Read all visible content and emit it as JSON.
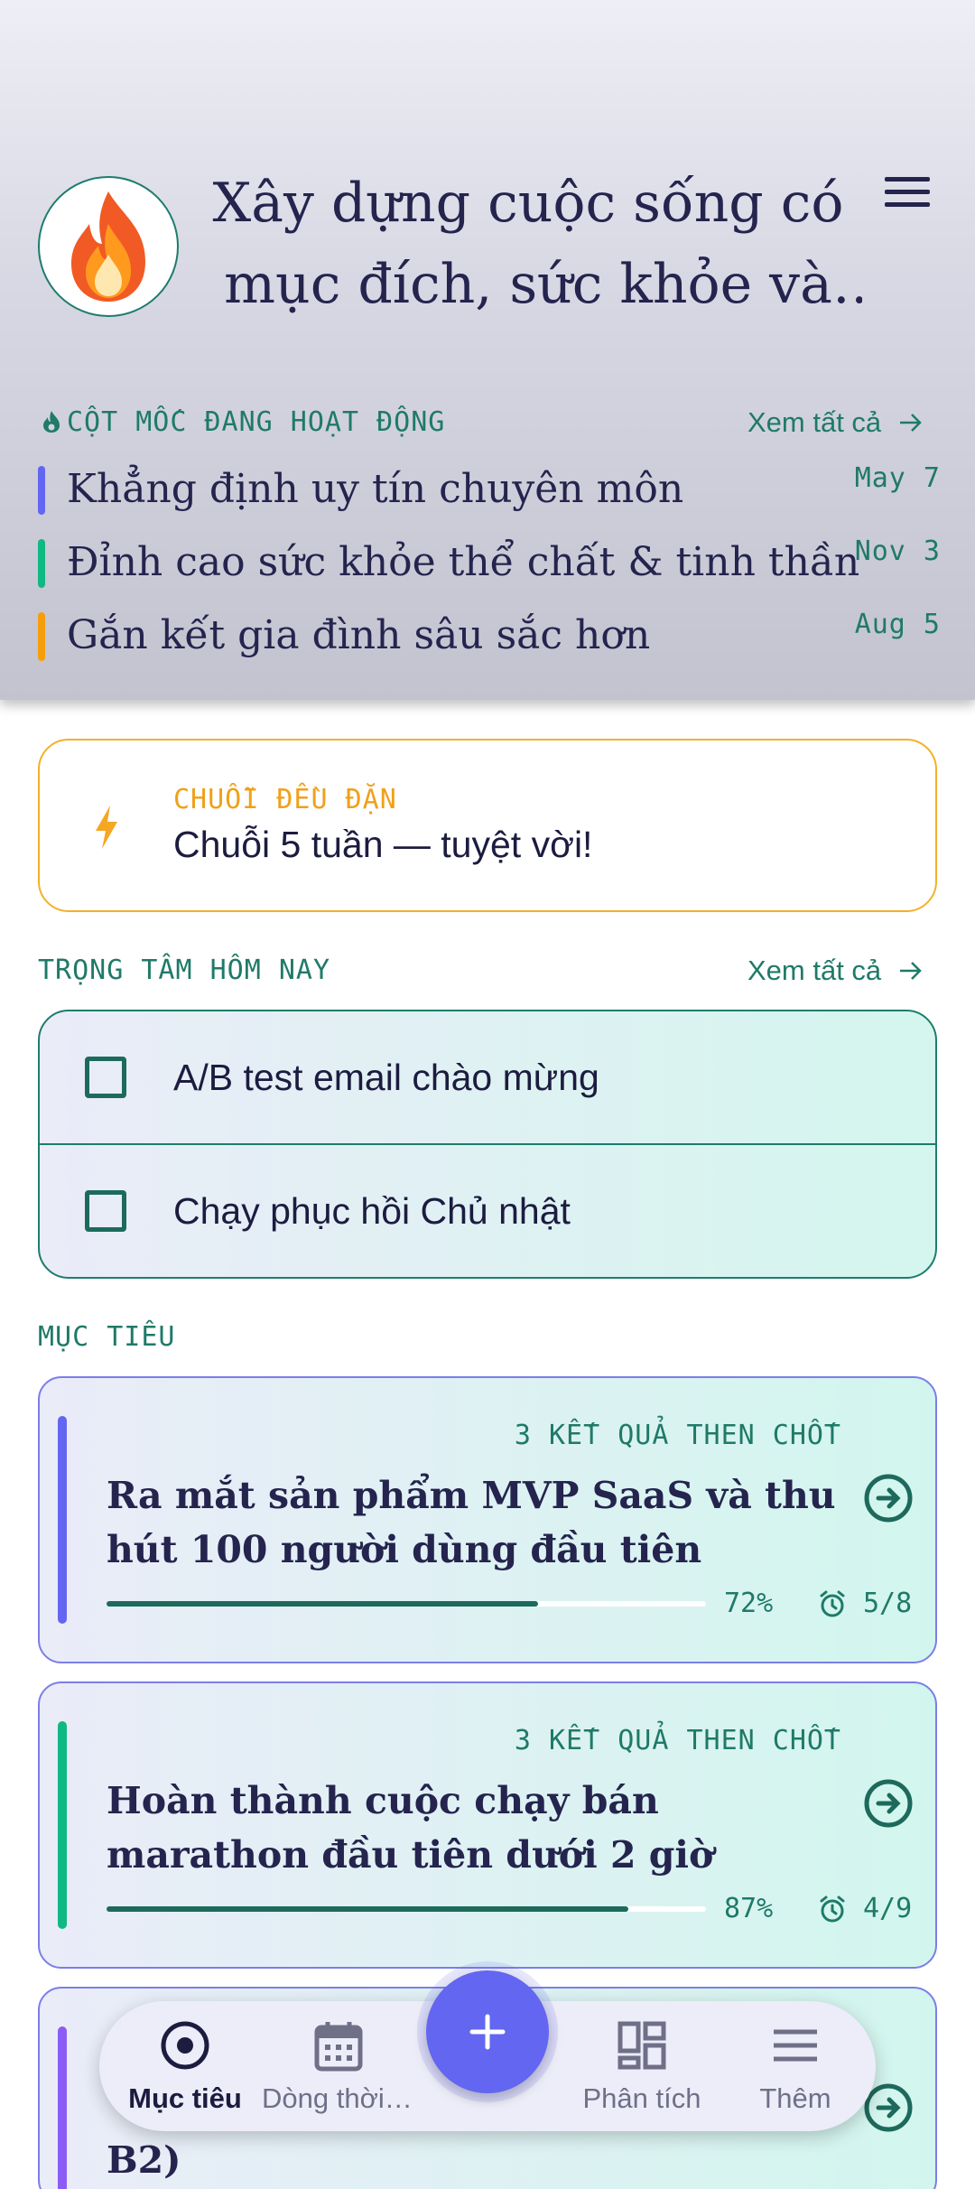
{
  "header": {
    "title": "Xây dựng cuộc sống có mục đích, sức khỏe và tinh thần",
    "avatar_icon": "fire-icon",
    "menu_icon": "hamburger-icon"
  },
  "milestones": {
    "label": "CỘT MỐC ĐANG HOẠT ĐỘNG",
    "see_all": "Xem tất cả",
    "items": [
      {
        "text": "Khẳng định uy tín chuyên môn",
        "date": "May 7",
        "color": "#6366f1"
      },
      {
        "text": "Đỉnh cao sức khỏe thể chất & tinh thần",
        "date": "Nov 3",
        "color": "#10b981"
      },
      {
        "text": "Gắn kết gia đình sâu sắc hơn",
        "date": "Aug 5",
        "color": "#f59e0b"
      }
    ]
  },
  "streak": {
    "label": "CHUỖI ĐỀU ĐẶN",
    "text": "Chuỗi 5 tuần — tuyệt vời!"
  },
  "focus": {
    "label": "TRỌNG TÂM HÔM NAY",
    "see_all": "Xem tất cả",
    "items": [
      {
        "text": "A/B test email chào mừng",
        "checked": false
      },
      {
        "text": "Chạy phục hồi Chủ nhật",
        "checked": false
      }
    ]
  },
  "goals": {
    "label": "MỤC TIÊU",
    "items": [
      {
        "kr": "3 KẾT QUẢ THEN CHỐT",
        "title": "Ra mắt sản phẩm MVP SaaS và thu hút 100 người dùng đầu tiên",
        "progress": 0.72,
        "pct": "72%",
        "count": "5/8",
        "color": "#6366f1"
      },
      {
        "kr": "3 KẾT QUẢ THEN CHỐT",
        "title": "Hoàn thành cuộc chạy bán marathon đầu tiên dưới 2 giờ",
        "progress": 0.87,
        "pct": "87%",
        "count": "4/9",
        "color": "#10b981"
      },
      {
        "kr": "",
        "title": "B2)",
        "progress": 0,
        "pct": "",
        "count": "",
        "color": "#8b5cf6"
      }
    ]
  },
  "nav": {
    "items": [
      {
        "label": "Mục tiêu",
        "icon": "target-icon",
        "active": true
      },
      {
        "label": "Dòng thời gian",
        "icon": "calendar-icon",
        "active": false
      },
      {
        "label": "Phân tích",
        "icon": "dashboard-icon",
        "active": false
      },
      {
        "label": "Thêm",
        "icon": "menu-icon",
        "active": false
      }
    ],
    "fab_icon": "plus-icon"
  }
}
